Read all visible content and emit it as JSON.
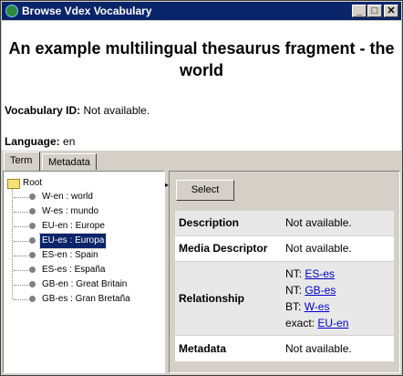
{
  "window": {
    "title": "Browse Vdex Vocabulary",
    "buttons": {
      "minimize": "_",
      "maximize": "□",
      "close": "✕"
    }
  },
  "header": {
    "title": "An example multilingual thesaurus fragment - the world",
    "vocabulary_id_label": "Vocabulary ID:",
    "vocabulary_id_value": "Not available.",
    "language_label": "Language:",
    "language_value": "en"
  },
  "tabs": [
    {
      "label": "Term",
      "active": true
    },
    {
      "label": "Metadata",
      "active": false
    }
  ],
  "tree": {
    "root_label": "Root",
    "items": [
      {
        "label": "W-en : world",
        "selected": false
      },
      {
        "label": "W-es : mundo",
        "selected": false
      },
      {
        "label": "EU-en : Europe",
        "selected": false
      },
      {
        "label": "EU-es : Europa",
        "selected": true
      },
      {
        "label": "ES-en : Spain",
        "selected": false
      },
      {
        "label": "ES-es : España",
        "selected": false
      },
      {
        "label": "GB-en : Great Britain",
        "selected": false
      },
      {
        "label": "GB-es : Gran Bretaña",
        "selected": false
      }
    ]
  },
  "details": {
    "select_label": "Select",
    "description_label": "Description",
    "description_value": "Not available.",
    "media_label": "Media Descriptor",
    "media_value": "Not available.",
    "relationship_label": "Relationship",
    "relationships": [
      {
        "type": "NT:",
        "target": "ES-es"
      },
      {
        "type": "NT:",
        "target": "GB-es"
      },
      {
        "type": "BT:",
        "target": "W-es"
      },
      {
        "type": "exact:",
        "target": "EU-en"
      }
    ],
    "metadata_label": "Metadata",
    "metadata_value": "Not available."
  },
  "colors": {
    "titlebar": "#0a246a",
    "window_face": "#d4d0c8",
    "selection": "#0a246a",
    "link": "#0000cc"
  }
}
